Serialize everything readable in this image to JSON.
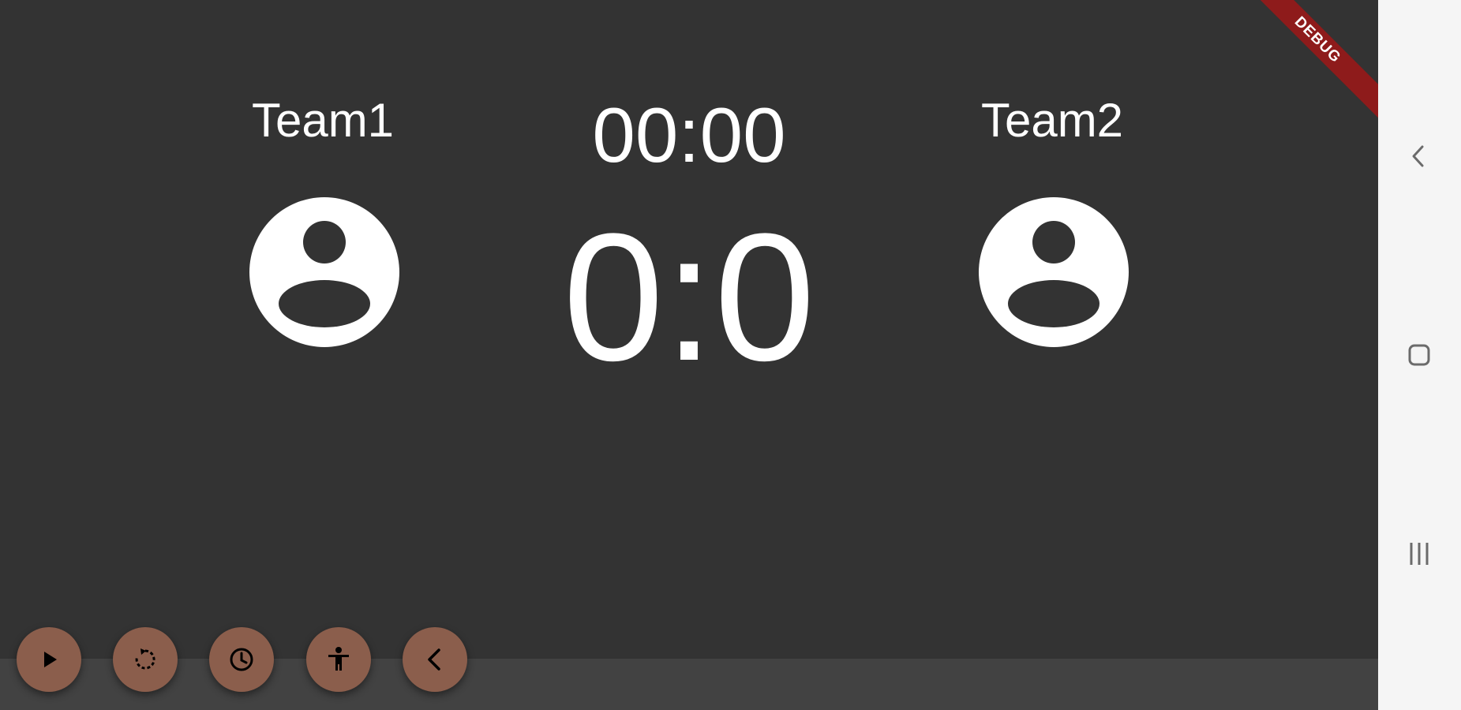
{
  "scoreboard": {
    "team1_name": "Team1",
    "team2_name": "Team2",
    "timer": "00:00",
    "score": "0:0"
  },
  "icons": {
    "team1_avatar": "account-circle-icon",
    "team2_avatar": "account-circle-icon",
    "fab_play": "play-icon",
    "fab_reset": "reset-icon",
    "fab_timer": "clock-icon",
    "fab_accessibility": "accessibility-icon",
    "fab_back": "chevron-left-icon"
  },
  "debug_banner": "DEBUG",
  "colors": {
    "background": "#333333",
    "bottom_bar": "#424242",
    "fab": "#8b5e4c",
    "debug_ribbon": "#8e1b1b",
    "nav_bar": "#f5f5f5"
  }
}
